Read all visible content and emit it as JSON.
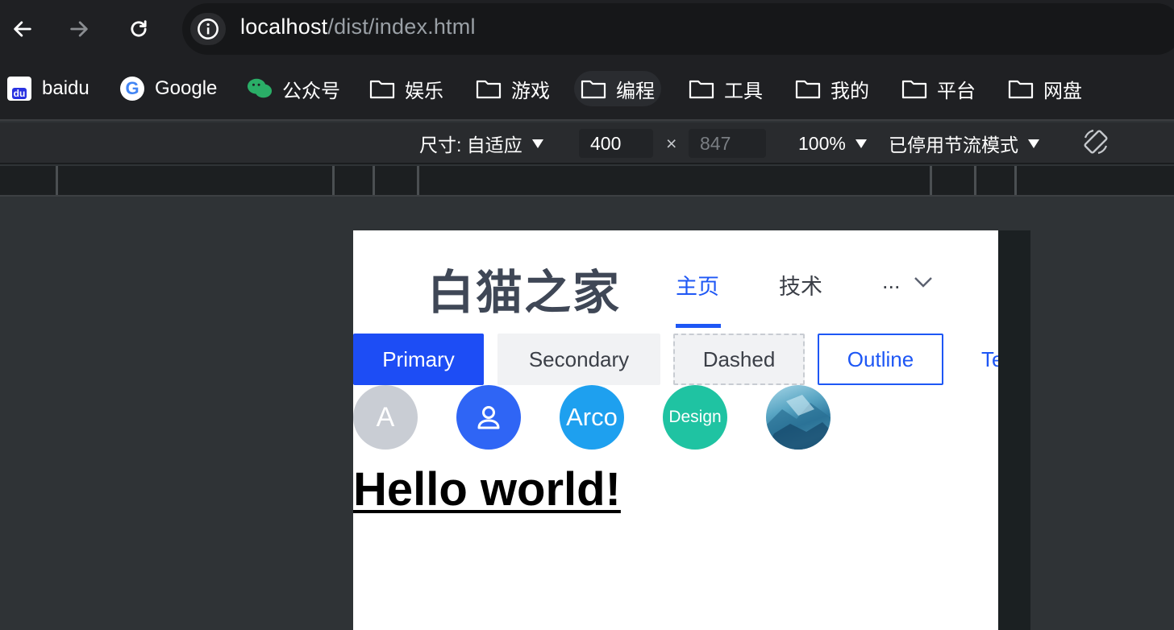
{
  "browser": {
    "url_host": "localhost",
    "url_path": "/dist/index.html",
    "icons": {
      "back": "arrow-left-icon",
      "forward": "arrow-right-icon",
      "reload": "reload-icon",
      "info": "info-icon"
    }
  },
  "bookmarks": [
    {
      "label": "baidu",
      "icon": "baidu-icon"
    },
    {
      "label": "Google",
      "icon": "google-icon"
    },
    {
      "label": "公众号",
      "icon": "wechat-icon"
    },
    {
      "label": "娱乐",
      "icon": "folder-icon"
    },
    {
      "label": "游戏",
      "icon": "folder-icon"
    },
    {
      "label": "编程",
      "icon": "folder-icon"
    },
    {
      "label": "工具",
      "icon": "folder-icon"
    },
    {
      "label": "我的",
      "icon": "folder-icon"
    },
    {
      "label": "平台",
      "icon": "folder-icon"
    },
    {
      "label": "网盘",
      "icon": "folder-icon"
    }
  ],
  "devtools": {
    "dimension_label": "尺寸: 自适应",
    "width_value": "400",
    "times": "×",
    "height_placeholder": "847",
    "zoom": "100%",
    "throttle": "已停用节流模式"
  },
  "page": {
    "site_title": "白猫之家",
    "menu": {
      "home": "主页",
      "tech": "技术",
      "more": "..."
    },
    "buttons": {
      "primary": "Primary",
      "secondary": "Secondary",
      "dashed": "Dashed",
      "outline": "Outline",
      "text": "Text"
    },
    "avatars": {
      "letter": "A",
      "arco": "Arco",
      "design": "Design"
    },
    "heading": "Hello world!"
  },
  "colors": {
    "accent": "#1e57f5",
    "primary_button": "#1d4df5",
    "avatar_gray": "#c9cdd4",
    "avatar_blue": "#2f65f5",
    "avatar_sky": "#1ea0ef",
    "avatar_teal": "#1fc3a2",
    "browser_bar": "#1f2023"
  }
}
